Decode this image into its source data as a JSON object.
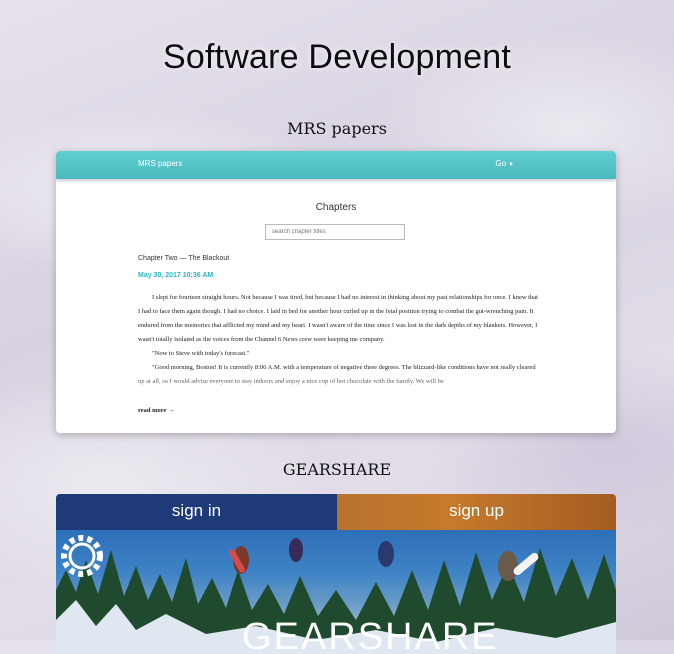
{
  "page": {
    "title": "Software Development"
  },
  "sections": {
    "mrs": {
      "heading": "MRS papers",
      "nav": {
        "brand": "MRS papers",
        "go": "Go"
      },
      "chapters_title": "Chapters",
      "search_placeholder": "search chapter titles",
      "chapter": {
        "name": "Chapter Two — The Blackout",
        "date": "May 30, 2017 10:36 AM",
        "paragraphs": [
          "I slept for fourteen straight hours. Not because I was tired, but because I had no interest in thinking about my past relationships for once. I knew that I had to face them again though. I had no choice. I laid in bed for another hour curled up in the fetal position trying to combat the gut-wrenching pain. It endured from the memories that afflicted my mind and my heart. I wasn't aware of the time since I was lost in the dark depths of my blankets. However, I wasn't totally isolated as the voices from the Channel 6 News crew were keeping me company.",
          "\"Now to Steve with today's forecast.\"",
          "\"Good morning, Boston! It is currently 8:06 A.M. with a temperature of negative three degrees. The blizzard-like conditions have not really cleared up at all, so I would advise everyone to stay indoors and enjoy a nice cup of hot chocolate with the family. We will be"
        ],
        "read_more": "read more →"
      }
    },
    "gearshare": {
      "heading": "GEARSHARE",
      "sign_in": "sign in",
      "sign_up": "sign up",
      "logo_text": "GEARSHARE"
    }
  },
  "colors": {
    "mrs_nav": "#49b9bf",
    "mrs_date": "#2ab5bd",
    "gear_signin": "#1e3a78",
    "gear_signup": "#c67a2c"
  },
  "icons": {
    "gear_logo": "gear-icon",
    "go_caret": "caret-down-icon"
  }
}
